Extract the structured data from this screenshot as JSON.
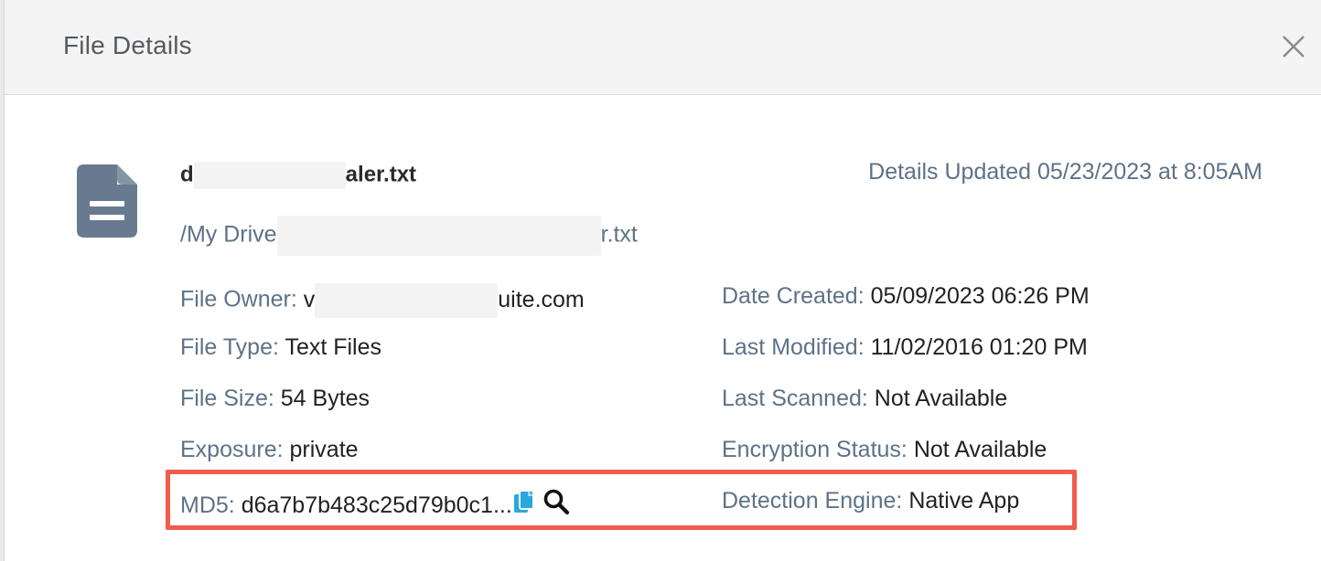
{
  "modal": {
    "title": "File Details"
  },
  "file": {
    "name_prefix": "d",
    "name_suffix": "aler.txt",
    "path_prefix": "/My Drive",
    "path_suffix": "r.txt",
    "updated": "Details Updated 05/23/2023 at 8:05AM"
  },
  "details": {
    "owner_label": "File Owner:",
    "owner_prefix": "v",
    "owner_suffix": "uite.com",
    "type_label": "File Type:",
    "type_value": "Text Files",
    "size_label": "File Size:",
    "size_value": "54 Bytes",
    "exposure_label": "Exposure:",
    "exposure_value": "private",
    "md5_label": "MD5:",
    "md5_value": "d6a7b7b483c25d79b0c1...",
    "created_label": "Date Created:",
    "created_value": "05/09/2023 06:26 PM",
    "modified_label": "Last Modified:",
    "modified_value": "11/02/2016 01:20 PM",
    "scanned_label": "Last Scanned:",
    "scanned_value": "Not Available",
    "encryption_label": "Encryption Status:",
    "encryption_value": "Not Available",
    "engine_label": "Detection Engine:",
    "engine_value": "Native App"
  },
  "icons": {
    "file": "file-text-icon",
    "close": "close-icon",
    "copy": "copy-icon",
    "search": "search-icon"
  },
  "colors": {
    "label": "#5d7287",
    "value": "#222222",
    "file_icon": "#677a8f",
    "copy_icon": "#29a8e0",
    "highlight": "#f25c4d"
  }
}
